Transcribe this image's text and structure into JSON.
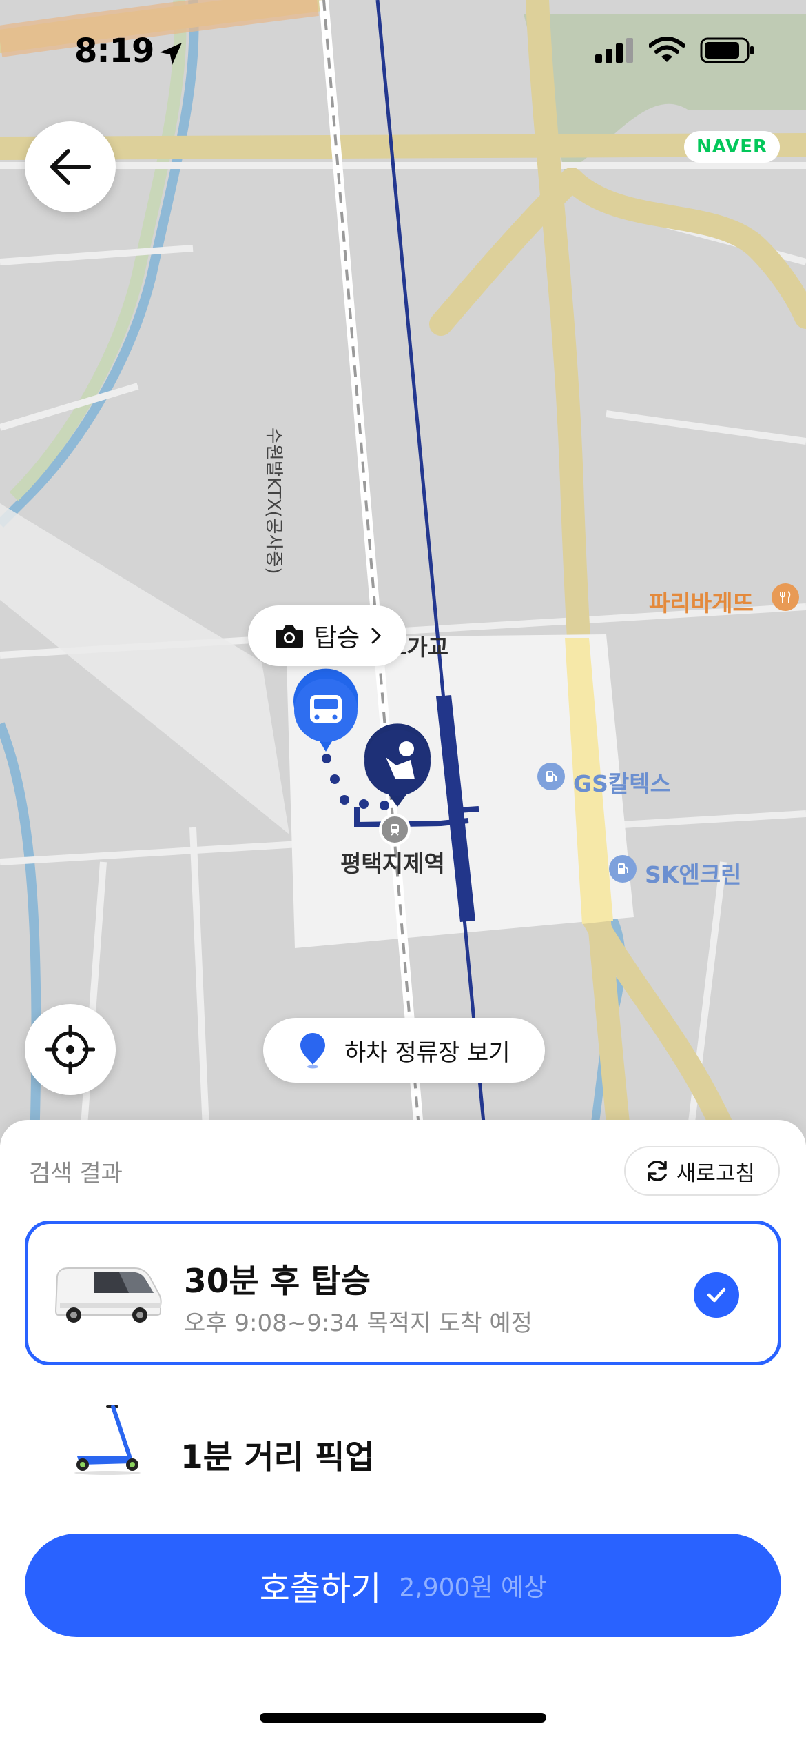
{
  "status_bar": {
    "time": "8:19",
    "icons": [
      "location-arrow-icon",
      "signal-icon",
      "wifi-icon",
      "battery-icon"
    ]
  },
  "map": {
    "provider_badge": "NAVER",
    "labels": {
      "station": "평택지제역",
      "overpass": "고가교",
      "gas_station_1": "GS칼텍스",
      "gas_station_2": "SK엔크린",
      "bakery": "파리바게뜨",
      "rail_line": "수원발KTX(공사중)"
    },
    "board_chip": {
      "icon": "camera-icon",
      "label": "탑승"
    },
    "dropoff_chip": {
      "icon": "pin-icon",
      "label": "하차 정류장 보기"
    },
    "markers": [
      "bus-stop-marker",
      "user-marker",
      "station-marker"
    ]
  },
  "sheet": {
    "results_title": "검색 결과",
    "refresh_label": "새로고침",
    "options": [
      {
        "icon": "van-icon",
        "title": "30분 후 탑승",
        "subtitle": "오후 9:08~9:34 목적지 도착 예정",
        "selected": true
      },
      {
        "icon": "scooter-icon",
        "title": "1분 거리 픽업",
        "selected": false
      }
    ],
    "call_button": {
      "label": "호출하기",
      "price": "2,900원 예상"
    }
  },
  "colors": {
    "accent": "#2962ff",
    "naver": "#03c75a",
    "map_bg": "#d4d4d4",
    "road": "#ddd09a",
    "water": "#8fb9d6"
  }
}
